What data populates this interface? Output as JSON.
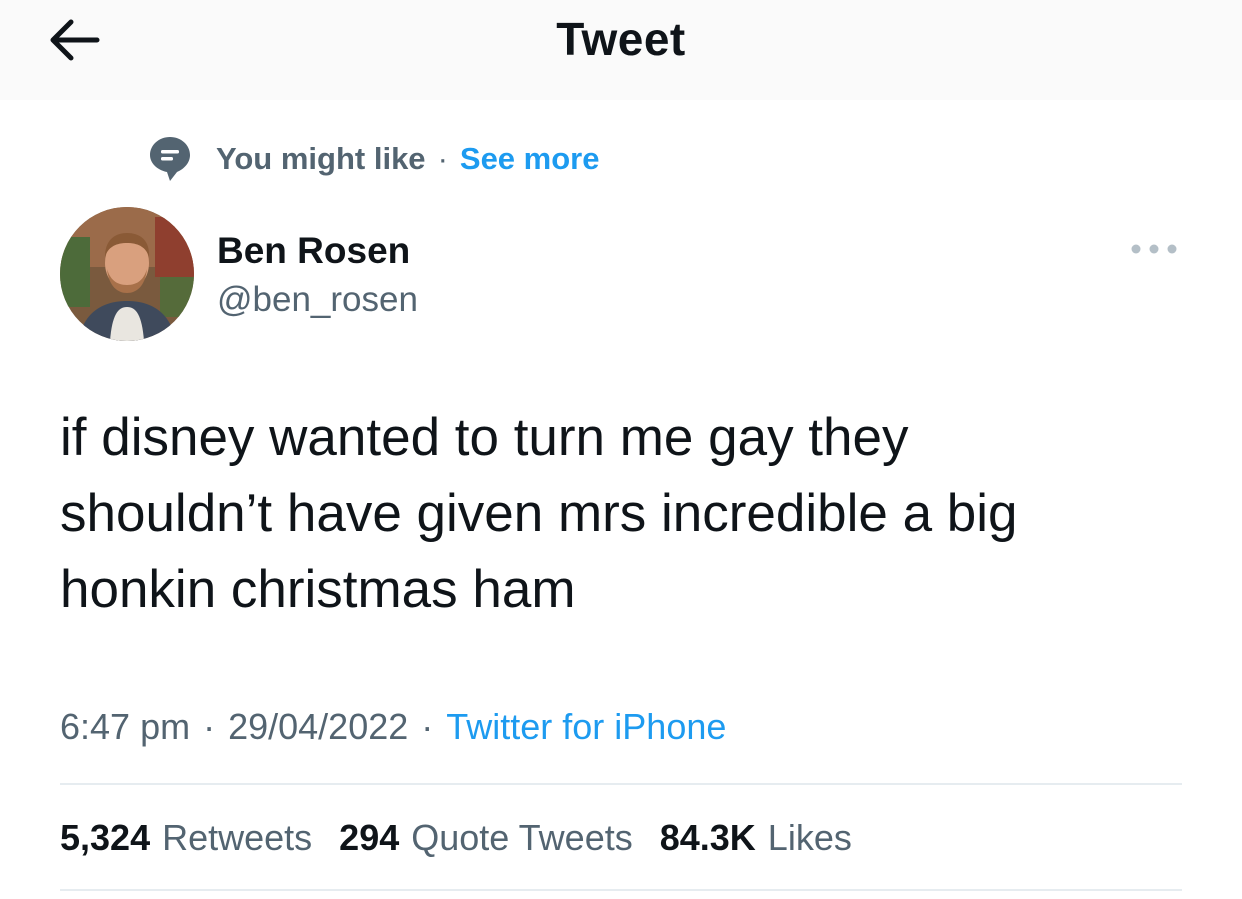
{
  "header": {
    "title": "Tweet",
    "back_icon": "arrow-left-icon"
  },
  "context": {
    "icon": "speech-bubble-icon",
    "label": "You might like",
    "separator": "·",
    "link": "See more"
  },
  "author": {
    "name": "Ben Rosen",
    "handle": "@ben_rosen",
    "avatar": "profile-photo"
  },
  "tweet": {
    "text": "if disney wanted to turn me gay they\nshouldn’t have given mrs incredible a big\nhonkin christmas ham",
    "time": "6:47 pm",
    "date": "29/04/2022",
    "source": "Twitter for iPhone",
    "separator": "·"
  },
  "stats": {
    "retweets_count": "5,324",
    "retweets_label": "Retweets",
    "quotes_count": "294",
    "quotes_label": "Quote Tweets",
    "likes_count": "84.3K",
    "likes_label": "Likes"
  },
  "colors": {
    "accent": "#1d9bf0",
    "text_primary": "#0f1419",
    "text_secondary": "#536471",
    "divider": "#e6ecf0"
  }
}
